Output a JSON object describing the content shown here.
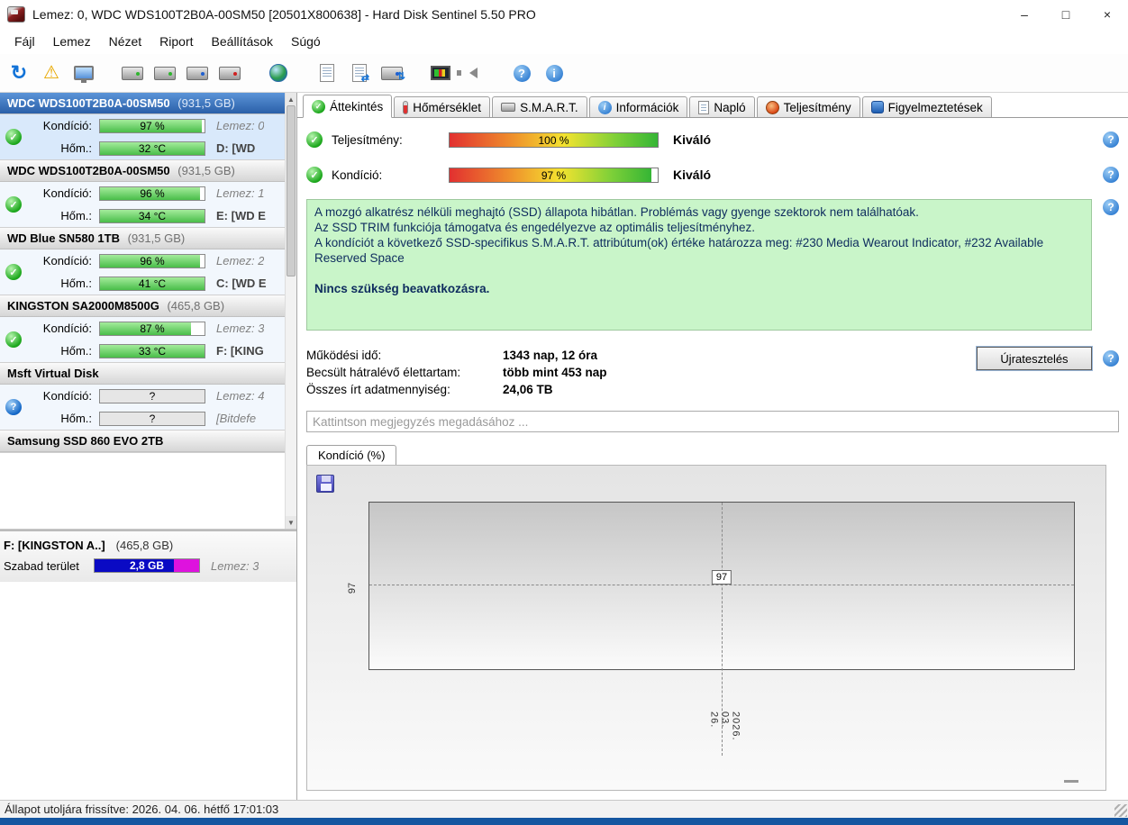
{
  "titlebar": {
    "title": "Lemez: 0, WDC  WDS100T2B0A-00SM50 [20501X800638]  -  Hard Disk Sentinel 5.50 PRO",
    "controls": {
      "minimize": "–",
      "maximize": "□",
      "close": "×"
    }
  },
  "menubar": [
    "Fájl",
    "Lemez",
    "Nézet",
    "Riport",
    "Beállítások",
    "Súgó"
  ],
  "toolbar": {
    "help_glyph": "?",
    "info_glyph": "i",
    "refresh_glyph": "↻",
    "warning_glyph": "⚠"
  },
  "tabs": [
    {
      "label": "Áttekintés"
    },
    {
      "label": "Hőmérséklet"
    },
    {
      "label": "S.M.A.R.T."
    },
    {
      "label": "Információk"
    },
    {
      "label": "Napló"
    },
    {
      "label": "Teljesítmény"
    },
    {
      "label": "Figyelmeztetések"
    }
  ],
  "sidebar": {
    "labels": {
      "condition": "Kondíció:",
      "temperature": "Hőm.:"
    },
    "disks": [
      {
        "name": "WDC  WDS100T2B0A-00SM50",
        "size": "(931,5 GB)",
        "condition": "97 %",
        "condition_width": "97%",
        "temperature": "32 °C",
        "disk_no": "Lemez: 0",
        "drive": "D: [WD"
      },
      {
        "name": "WDC  WDS100T2B0A-00SM50",
        "size": "(931,5 GB)",
        "condition": "96 %",
        "condition_width": "96%",
        "temperature": "34 °C",
        "disk_no": "Lemez: 1",
        "drive": "E: [WD E"
      },
      {
        "name": "WD Blue SN580 1TB",
        "size": "(931,5 GB)",
        "condition": "96 %",
        "condition_width": "96%",
        "temperature": "41 °C",
        "disk_no": "Lemez: 2",
        "drive": "C: [WD E"
      },
      {
        "name": "KINGSTON SA2000M8500G",
        "size": "(465,8 GB)",
        "condition": "87 %",
        "condition_width": "87%",
        "temperature": "33 °C",
        "disk_no": "Lemez: 3",
        "drive": "F: [KING"
      },
      {
        "name": "Msft   Virtual Disk",
        "size": "",
        "condition": "?",
        "condition_width": "0%",
        "temperature": "?",
        "disk_no": "Lemez: 4",
        "drive": "[Bitdefe"
      },
      {
        "name": "Samsung SSD 860 EVO 2TB",
        "size": ""
      }
    ],
    "scroll": {
      "up": "▲",
      "down": "▼"
    },
    "volume": {
      "title": "F: [KINGSTON A..]",
      "size": "(465,8 GB)",
      "free_label": "Szabad terület",
      "free_value": "2,8 GB",
      "disk_no": "Lemez: 3"
    }
  },
  "overview": {
    "performance": {
      "label": "Teljesítmény:",
      "value": "100 %",
      "width": "100%",
      "rating": "Kiváló"
    },
    "condition": {
      "label": "Kondíció:",
      "value": "97 %",
      "width": "97%",
      "rating": "Kiváló"
    },
    "status_lines": [
      "A mozgó alkatrész nélküli meghajtó (SSD) állapota hibátlan. Problémás vagy gyenge szektorok nem találhatóak.",
      "Az SSD TRIM funkciója támogatva és engedélyezve az optimális teljesítményhez.",
      "A kondíciót a következő SSD-specifikus S.M.A.R.T. attribútum(ok) értéke határozza meg:  #230 Media Wearout Indicator, #232 Available Reserved Space"
    ],
    "status_bold": "Nincs szükség beavatkozásra.",
    "stats": [
      {
        "label": "Működési idő:",
        "value": "1343 nap, 12 óra"
      },
      {
        "label": "Becsült hátralévő élettartam:",
        "value": "több mint 453 nap"
      },
      {
        "label": "Összes írt adatmennyiség:",
        "value": "24,06 TB"
      }
    ],
    "retest_button": "Újratesztelés",
    "comment_placeholder": "Kattintson megjegyzés megadásához ...",
    "chart_tab": "Kondíció  (%)"
  },
  "chart_data": {
    "type": "line",
    "title": "Kondíció (%)",
    "x": [
      "2026. 03. 26."
    ],
    "values": [
      97
    ],
    "point_label": "97",
    "y_axis_label": "97",
    "ylabel": "Kondíció (%)",
    "grid": "dashed crosshair at single data point",
    "legend": "none"
  },
  "statusbar": {
    "text": "Állapot utoljára frissítve: 2026. 04. 06. hétfő 17:01:03"
  },
  "colors": {
    "status_box_bg": "#c9f5c9",
    "status_text": "#0e2c5e",
    "meter_green": "#49bd49",
    "selected_header_blue": "#2a5fa8",
    "free_bar_blue": "#0a0ac4",
    "free_bar_magenta": "#de12de",
    "perf_bar_gradient": [
      "#e23030",
      "#f4e32f",
      "#35b535"
    ],
    "bottom_strip": "#1456a0"
  }
}
